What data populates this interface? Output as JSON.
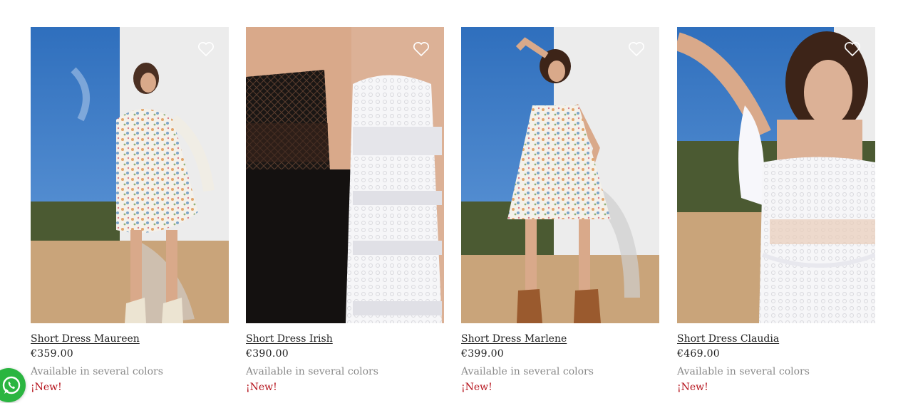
{
  "products": [
    {
      "name": "Short Dress Maureen",
      "price": "€359.00",
      "availability": "Available in several colors",
      "badge": "¡New!",
      "wishlist_icon": "heart-outline-icon",
      "image": "model-floral-long-sleeve-dress-cowboy-boots"
    },
    {
      "name": "Short Dress Irish",
      "price": "€390.00",
      "availability": "Available in several colors",
      "badge": "¡New!",
      "wishlist_icon": "heart-outline-icon",
      "image": "two-models-black-and-white-lace-dresses"
    },
    {
      "name": "Short Dress Marlene",
      "price": "€399.00",
      "availability": "Available in several colors",
      "badge": "¡New!",
      "wishlist_icon": "heart-outline-icon",
      "image": "model-floral-strap-dress-brown-boots"
    },
    {
      "name": "Short Dress Claudia",
      "price": "€469.00",
      "availability": "Available in several colors",
      "badge": "¡New!",
      "wishlist_icon": "heart-outline-icon",
      "image": "model-white-ruffle-lace-dress-closeup"
    }
  ],
  "whatsapp": {
    "icon": "whatsapp-icon",
    "color": "#2ab540"
  },
  "colors": {
    "badge": "#b5121b",
    "availability": "#8a8a8a",
    "text": "#222222"
  }
}
